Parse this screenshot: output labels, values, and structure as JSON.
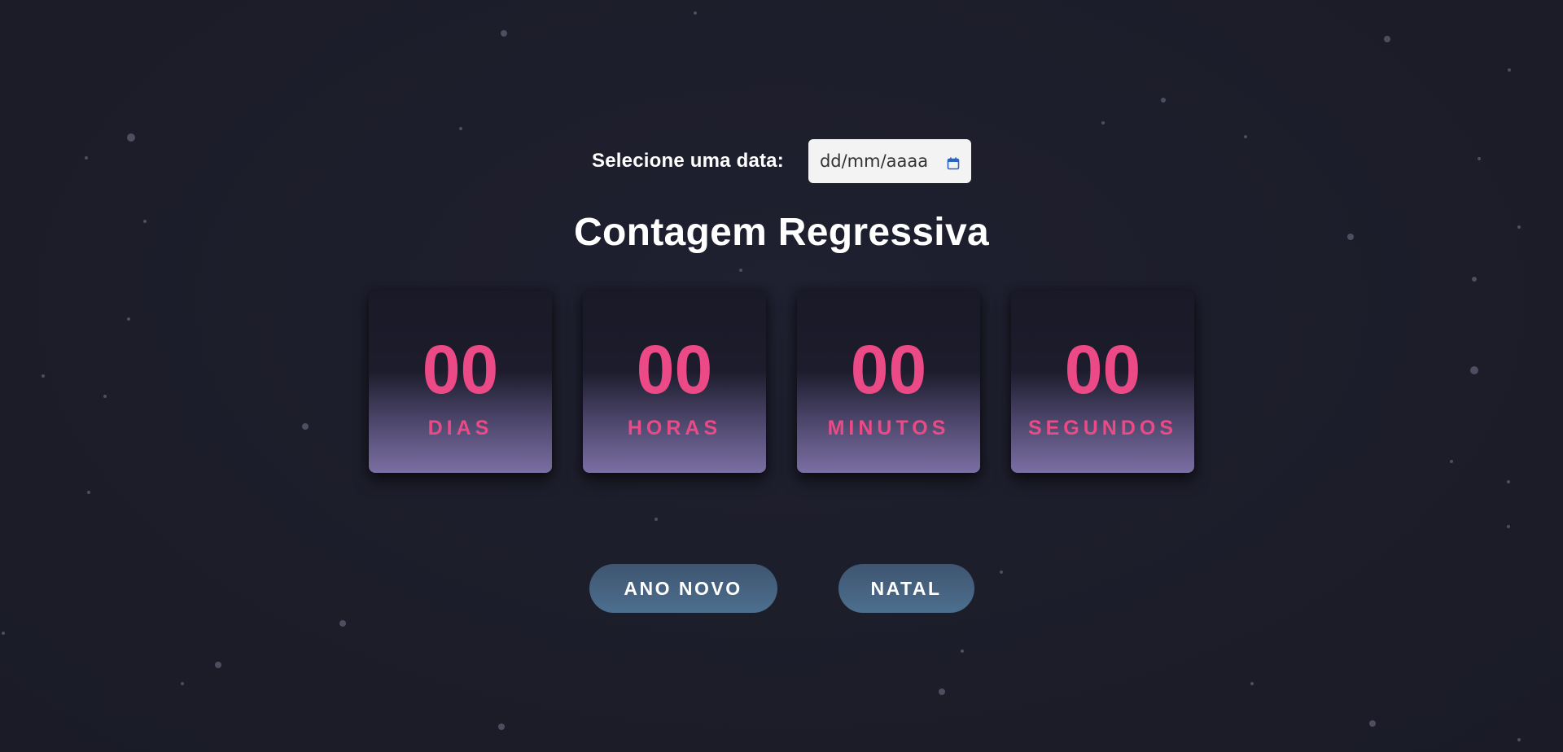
{
  "date_picker": {
    "label": "Selecione uma data:",
    "placeholder": "dd/mm/aaaa",
    "icon": "calendar-icon"
  },
  "title": "Contagem Regressiva",
  "countdown": [
    {
      "value": "00",
      "label": "DIAS"
    },
    {
      "value": "00",
      "label": "HORAS"
    },
    {
      "value": "00",
      "label": "MINUTOS"
    },
    {
      "value": "00",
      "label": "SEGUNDOS"
    }
  ],
  "buttons": {
    "new_year": "ANO NOVO",
    "christmas": "NATAL"
  },
  "colors": {
    "background": "#1d1e2b",
    "accent": "#ec4a86",
    "button": "#4d6f8f"
  }
}
